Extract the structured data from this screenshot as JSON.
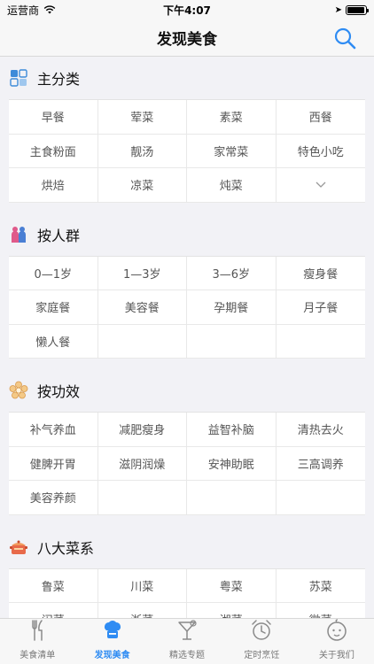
{
  "status": {
    "carrier": "运营商",
    "time": "下午4:07",
    "battery_level": 0.95
  },
  "nav": {
    "title": "发现美食"
  },
  "sections": [
    {
      "title": "主分类",
      "icon": "grid-category-icon",
      "items": [
        "早餐",
        "荤菜",
        "素菜",
        "西餐",
        "主食粉面",
        "靓汤",
        "家常菜",
        "特色小吃",
        "烘焙",
        "凉菜",
        "炖菜",
        "⌄"
      ]
    },
    {
      "title": "按人群",
      "icon": "people-icon",
      "items": [
        "0—1岁",
        "1—3岁",
        "3—6岁",
        "瘦身餐",
        "家庭餐",
        "美容餐",
        "孕期餐",
        "月子餐",
        "懒人餐",
        "",
        "",
        ""
      ]
    },
    {
      "title": "按功效",
      "icon": "flower-icon",
      "items": [
        "补气养血",
        "减肥瘦身",
        "益智补脑",
        "清热去火",
        "健脾开胃",
        "滋阴润燥",
        "安神助眠",
        "三高调养",
        "美容养颜",
        "",
        "",
        ""
      ]
    },
    {
      "title": "八大菜系",
      "icon": "pot-icon",
      "items": [
        "鲁菜",
        "川菜",
        "粤菜",
        "苏菜",
        "闽菜",
        "浙菜",
        "湘菜",
        "徽菜"
      ]
    }
  ],
  "tabs": [
    {
      "label": "美食清单",
      "icon": "fork-knife-icon",
      "active": false
    },
    {
      "label": "发现美食",
      "icon": "chef-hat-icon",
      "active": true
    },
    {
      "label": "精选专题",
      "icon": "cocktail-icon",
      "active": false
    },
    {
      "label": "定时烹饪",
      "icon": "alarm-clock-icon",
      "active": false
    },
    {
      "label": "关于我们",
      "icon": "baby-face-icon",
      "active": false
    }
  ],
  "colors": {
    "accent": "#2f8cf3",
    "background": "#f2f2f6"
  }
}
